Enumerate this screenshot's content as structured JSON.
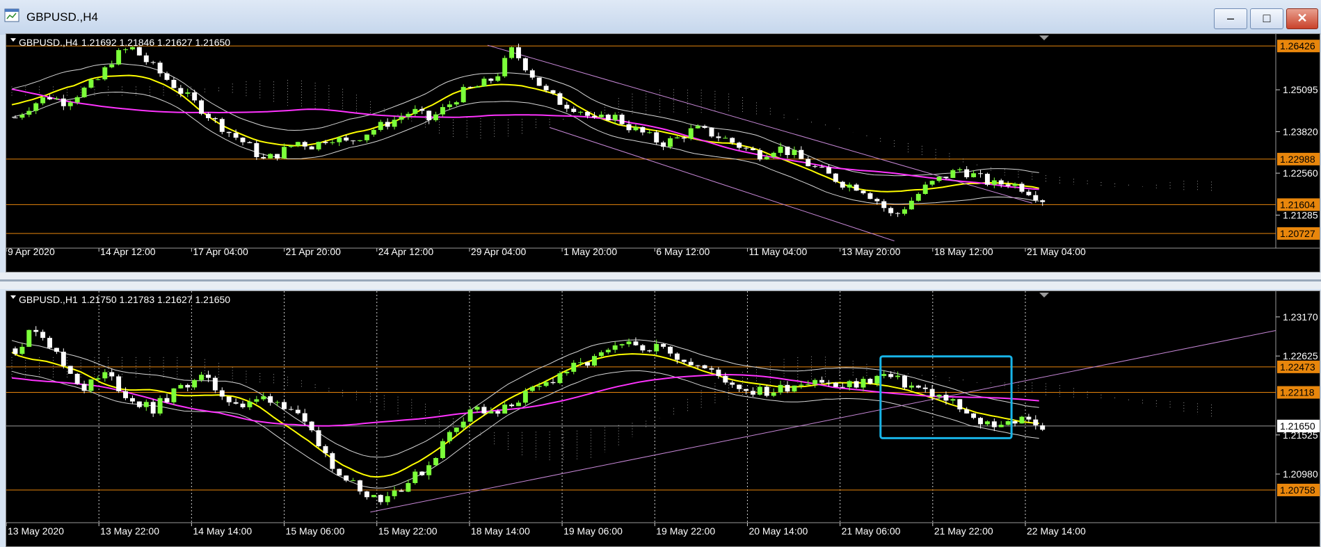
{
  "window": {
    "title": "GBPUSD.,H4"
  },
  "colors": {
    "up": "#7cff3a",
    "down": "#ffffff",
    "hline": "#e8860c",
    "ma_fast": "#ffff00",
    "ma_slow": "#ff33ff",
    "trend": "#c888d8",
    "bands": "#d8d8d8",
    "cloud": "#ffffff",
    "highlight": "#18b4e8",
    "bg": "#000000"
  },
  "panels": [
    {
      "id": "h4",
      "symbol_label": "GBPUSD.,H4",
      "ohlc_label": "1.21692 1.21846 1.21627 1.21650",
      "price_min": 1.2045,
      "price_max": 1.2662,
      "price_ticks": [
        "1.25095",
        "1.23820",
        "1.22560",
        "1.21285"
      ],
      "price_tick_values": [
        1.25095,
        1.2382,
        1.2256,
        1.21285
      ],
      "level_tags": [
        {
          "label": "1.26426",
          "value": 1.26426
        },
        {
          "label": "1.22988",
          "value": 1.22988
        },
        {
          "label": "1.21604",
          "value": 1.21604
        },
        {
          "label": "1.20727",
          "value": 1.20727
        }
      ],
      "time_labels": [
        "9 Apr 2020",
        "14 Apr 12:00",
        "17 Apr 04:00",
        "21 Apr 20:00",
        "24 Apr 12:00",
        "29 Apr 04:00",
        "1 May 20:00",
        "6 May 12:00",
        "11 May 04:00",
        "13 May 20:00",
        "18 May 12:00",
        "21 May 04:00"
      ],
      "close_path": [
        1.2425,
        1.2465,
        1.249,
        1.2472,
        1.2505,
        1.254,
        1.2612,
        1.2638,
        1.2592,
        1.2548,
        1.2504,
        1.2462,
        1.2416,
        1.2376,
        1.2342,
        1.2295,
        1.2318,
        1.2352,
        1.2338,
        1.2368,
        1.2348,
        1.2374,
        1.2398,
        1.2421,
        1.2446,
        1.2418,
        1.2457,
        1.2502,
        1.2521,
        1.2548,
        1.2632,
        1.2568,
        1.2502,
        1.2468,
        1.2452,
        1.2412,
        1.2434,
        1.2398,
        1.2374,
        1.2346,
        1.2362,
        1.2391,
        1.2376,
        1.2357,
        1.2331,
        1.2312,
        1.2336,
        1.2312,
        1.2278,
        1.2252,
        1.2224,
        1.2213,
        1.2174,
        1.2121,
        1.2169,
        1.2216,
        1.2244,
        1.2268,
        1.2246,
        1.2221,
        1.2228,
        1.2207,
        1.2176
      ]
    },
    {
      "id": "h1",
      "symbol_label": "GBPUSD.,H1",
      "ohlc_label": "1.21750 1.21783 1.21627 1.21650",
      "price_min": 1.2038,
      "price_max": 1.2345,
      "price_ticks": [
        "1.23170",
        "1.22625",
        "1.21525",
        "1.20980"
      ],
      "price_tick_values": [
        1.2317,
        1.22625,
        1.21525,
        1.2098
      ],
      "level_tags": [
        {
          "label": "1.22473",
          "value": 1.22473
        },
        {
          "label": "1.22118",
          "value": 1.22118
        },
        {
          "label": "1.21650",
          "value": 1.2165
        },
        {
          "label": "1.20758",
          "value": 1.20758
        }
      ],
      "time_labels": [
        "13 May 2020",
        "13 May 22:00",
        "14 May 14:00",
        "15 May 06:00",
        "15 May 22:00",
        "18 May 14:00",
        "19 May 06:00",
        "19 May 22:00",
        "20 May 14:00",
        "21 May 06:00",
        "21 May 22:00",
        "22 May 14:00"
      ],
      "close_path": [
        1.2273,
        1.2304,
        1.2254,
        1.2218,
        1.2238,
        1.2202,
        1.2188,
        1.2212,
        1.2236,
        1.2211,
        1.2191,
        1.2206,
        1.2192,
        1.2151,
        1.2108,
        1.2079,
        1.2064,
        1.2082,
        1.2106,
        1.2153,
        1.2192,
        1.2178,
        1.2202,
        1.2218,
        1.2241,
        1.2251,
        1.2268,
        1.2278,
        1.2276,
        1.2264,
        1.2247,
        1.2231,
        1.2216,
        1.2211,
        1.2222,
        1.2232,
        1.2218,
        1.2224,
        1.2236,
        1.2223,
        1.2212,
        1.2198,
        1.2171,
        1.2168,
        1.2173,
        1.2166
      ]
    }
  ]
}
